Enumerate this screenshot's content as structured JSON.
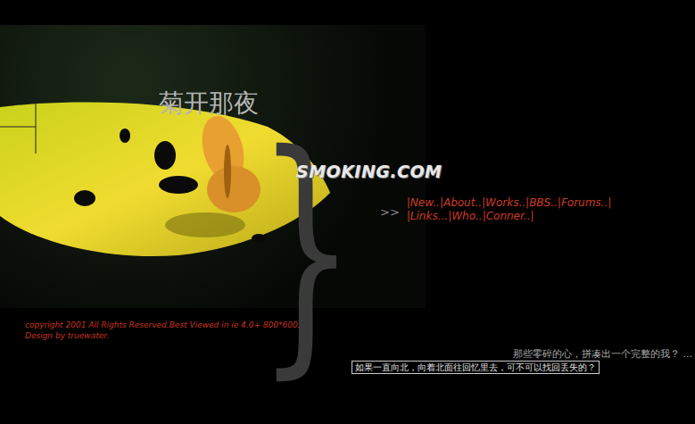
{
  "page": {
    "title": "菊开那夜",
    "logo": "SMOKING.COM",
    "brace": "}"
  },
  "nav": {
    "marker": ">>",
    "separator": "|",
    "rows": [
      [
        "New..",
        "About..",
        "Works..",
        "BBS..",
        "Forums.."
      ],
      [
        "Links...",
        "Who..",
        "Conner.."
      ]
    ]
  },
  "footer": {
    "copyright": "copyright 2001 All Rights Reserved.Best Viewed in ie 4.0+ 800*600.",
    "credit": "Design by truewater."
  },
  "quotes": {
    "line": "那些零碎的心，拼凑出一个完整的我？ ...",
    "boxed": "如果一直向北，向着北面往回忆里去，可不可以找回丢失的？"
  }
}
